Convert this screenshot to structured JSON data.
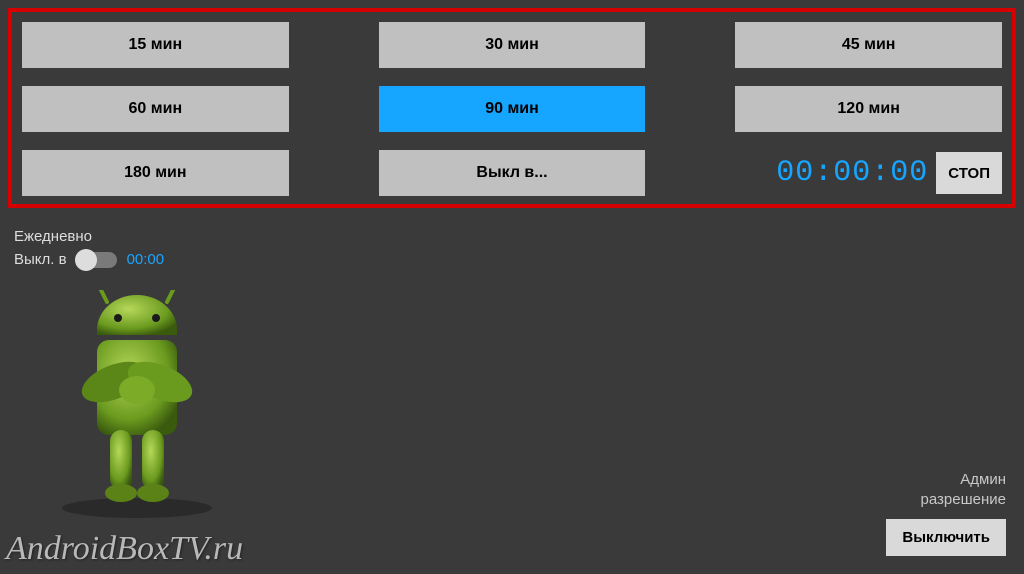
{
  "timer_buttons": {
    "b15": "15 мин",
    "b30": "30 мин",
    "b45": "45 мин",
    "b60": "60 мин",
    "b90": "90 мин",
    "b120": "120 мин",
    "b180": "180 мин",
    "custom": "Выкл в..."
  },
  "timer_display": "00:00:00",
  "stop_label": "СТОП",
  "daily": {
    "title": "Ежедневно",
    "off_at_label": "Выкл. в",
    "time": "00:00"
  },
  "admin": {
    "line1": "Админ",
    "line2": "разрешение"
  },
  "turn_off_label": "Выключить",
  "watermark": "AndroidBoxTV.ru",
  "selected_button": "b90",
  "colors": {
    "accent": "#17a6ff",
    "highlight_border": "#d60000"
  }
}
